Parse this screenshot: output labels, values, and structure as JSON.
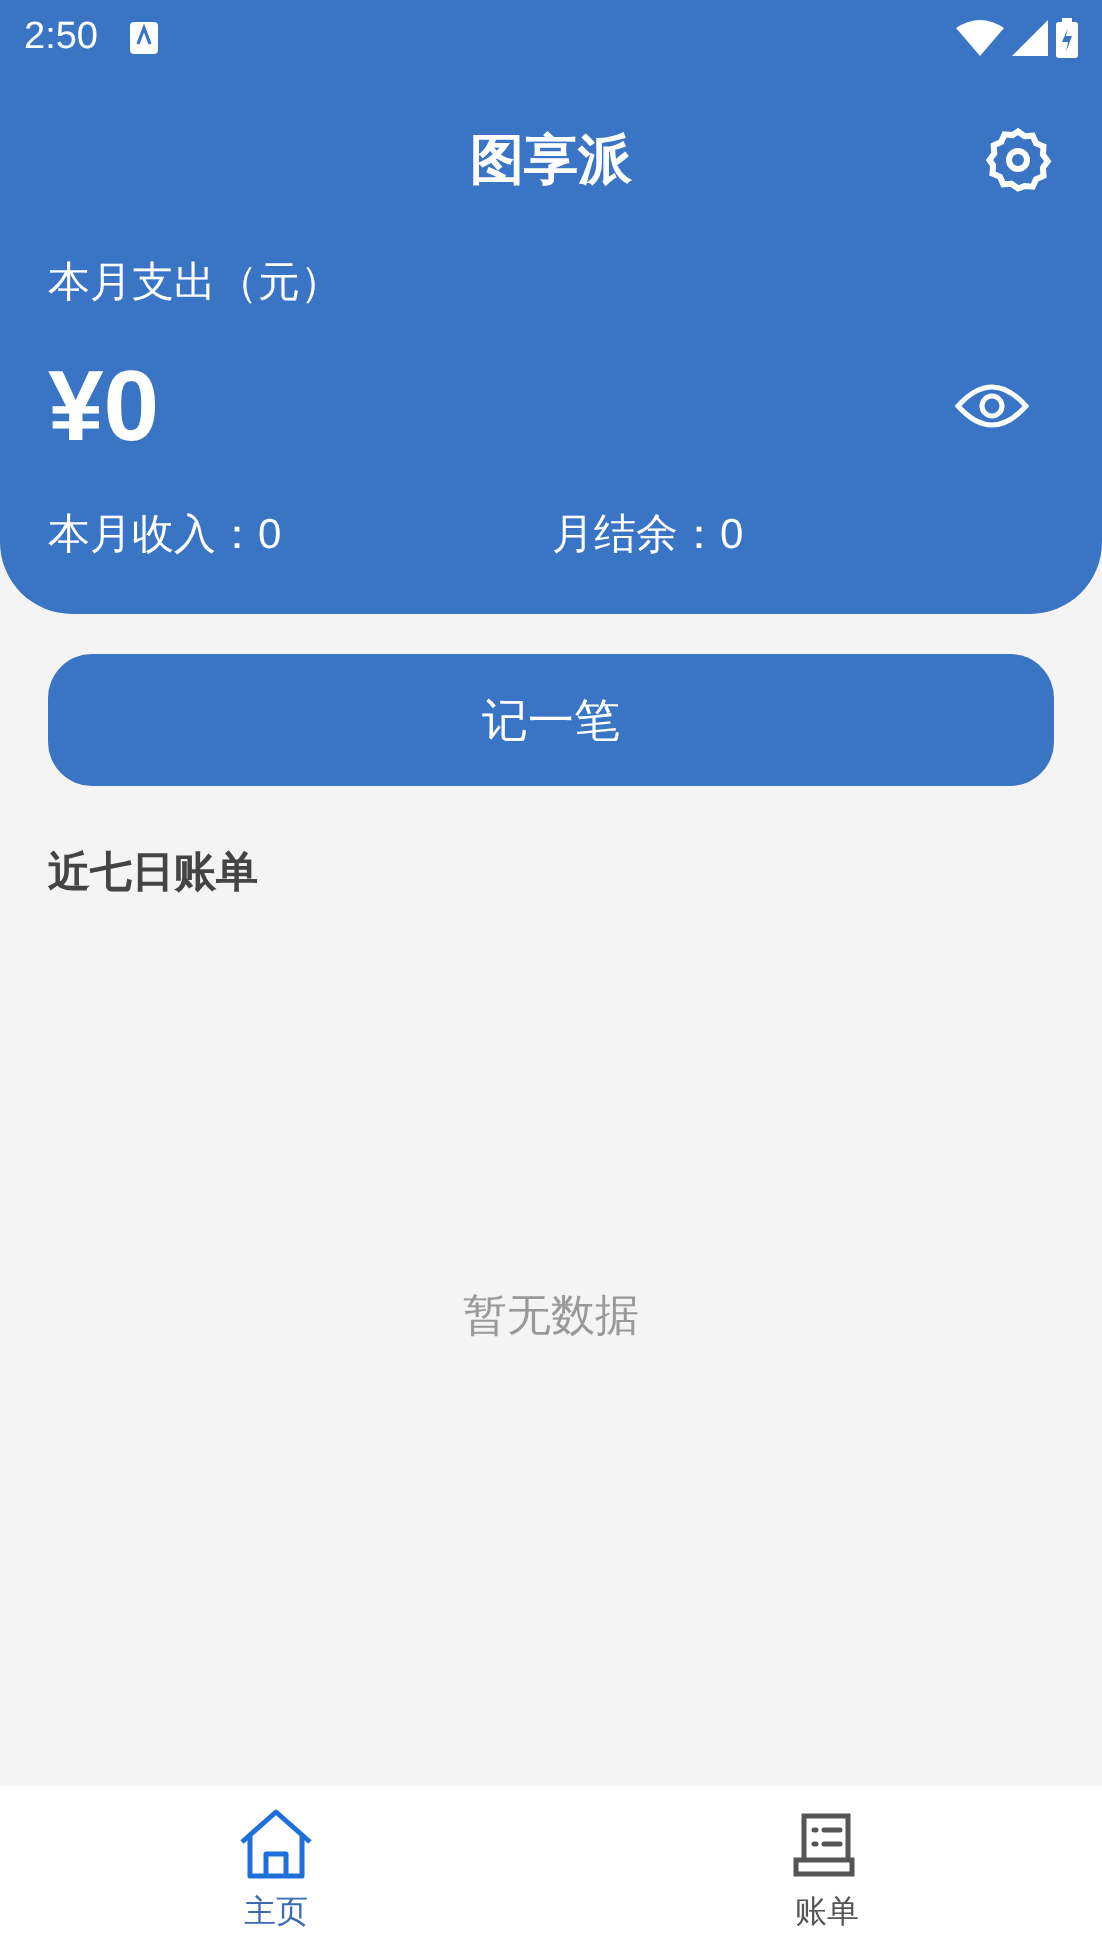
{
  "status_bar": {
    "time": "2:50"
  },
  "header": {
    "title": "图享派"
  },
  "summary": {
    "label": "本月支出（元）",
    "amount": "¥0",
    "income": "本月收入：0",
    "balance": "月结余：0"
  },
  "record_button": "记一笔",
  "recent": {
    "title": "近七日账单",
    "empty": "暂无数据"
  },
  "tabs": [
    {
      "label": "主页",
      "selected": true,
      "kind": "home"
    },
    {
      "label": "账单",
      "selected": false,
      "kind": "bill"
    }
  ]
}
